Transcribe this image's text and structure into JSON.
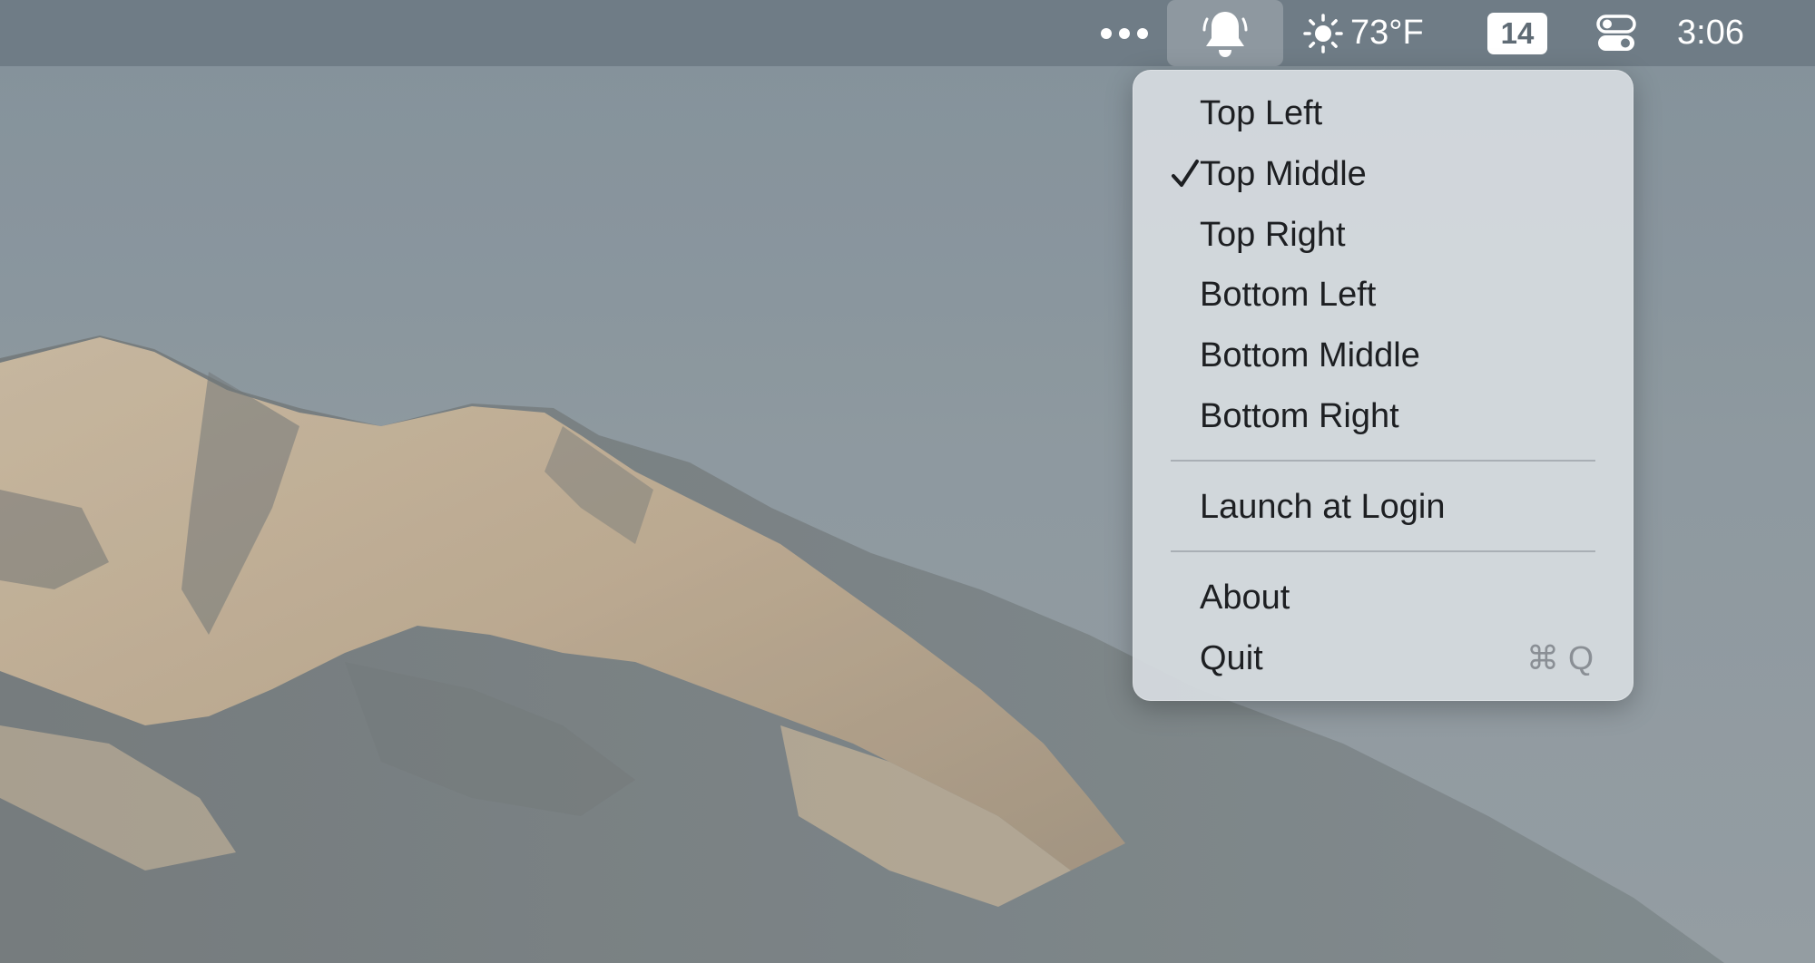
{
  "menubar": {
    "more_icon": "ellipsis-icon",
    "bell_icon": "bell-icon",
    "weather": {
      "icon": "sun-icon",
      "temperature": "73°F"
    },
    "date_badge": "14",
    "control_center_icon": "control-center-icon",
    "clock": "3:06"
  },
  "menu": {
    "position_items": [
      {
        "label": "Top Left",
        "checked": false
      },
      {
        "label": "Top Middle",
        "checked": true
      },
      {
        "label": "Top Right",
        "checked": false
      },
      {
        "label": "Bottom Left",
        "checked": false
      },
      {
        "label": "Bottom Middle",
        "checked": false
      },
      {
        "label": "Bottom Right",
        "checked": false
      }
    ],
    "launch_at_login": "Launch at Login",
    "about": "About",
    "quit": {
      "label": "Quit",
      "shortcut_symbol": "⌘",
      "shortcut_key": "Q"
    }
  },
  "colors": {
    "menubar": "#6f7c86",
    "menu_background": "#d6dbe0",
    "menu_text": "#1d1f22",
    "shortcut_text": "#8a8f95"
  }
}
